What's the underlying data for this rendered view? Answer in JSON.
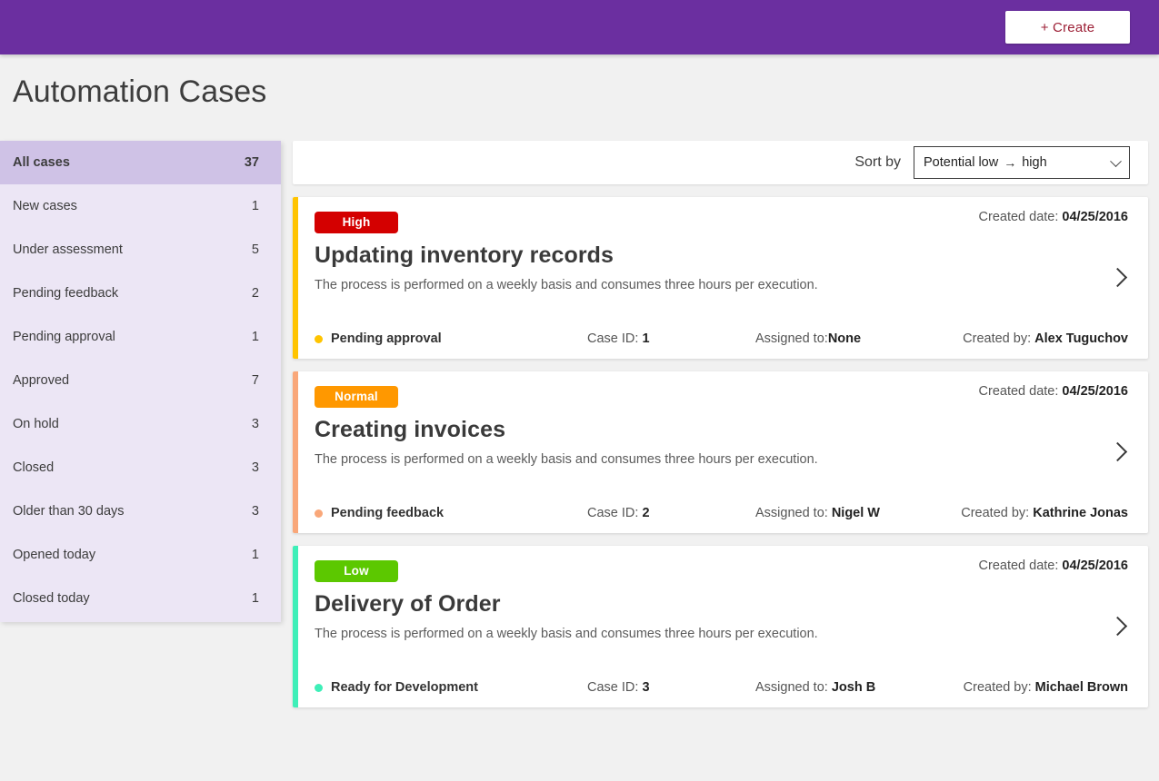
{
  "topbar": {
    "create_label": "+ Create",
    "bg_color": "#6b2fa0"
  },
  "page_title": "Automation Cases",
  "sidebar": {
    "items": [
      {
        "label": "All cases",
        "count": "37",
        "active": true
      },
      {
        "label": "New cases",
        "count": "1",
        "active": false
      },
      {
        "label": "Under assessment",
        "count": "5",
        "active": false
      },
      {
        "label": "Pending feedback",
        "count": "2",
        "active": false
      },
      {
        "label": "Pending approval",
        "count": "1",
        "active": false
      },
      {
        "label": "Approved",
        "count": "7",
        "active": false
      },
      {
        "label": "On hold",
        "count": "3",
        "active": false
      },
      {
        "label": "Closed",
        "count": "3",
        "active": false
      },
      {
        "label": "Older than 30 days",
        "count": "3",
        "active": false
      },
      {
        "label": "Opened today",
        "count": "1",
        "active": false
      },
      {
        "label": "Closed today",
        "count": "1",
        "active": false
      }
    ]
  },
  "sortbar": {
    "label": "Sort by",
    "selected": "Potential low",
    "arrow": "→",
    "selected_tail": "high",
    "options": [
      "Potential low → high"
    ]
  },
  "cards": [
    {
      "priority": "High",
      "priority_color": "#d40000",
      "accent_color": "#ffc400",
      "title": "Updating inventory records",
      "description": "The process is performed on a weekly basis and consumes three hours per execution.",
      "created_date_label": "Created date: ",
      "created_date": "04/25/2016",
      "status": "Pending approval",
      "status_dot_color": "#ffc400",
      "case_id_label": "Case ID: ",
      "case_id": "1",
      "assigned_label": "Assigned to:",
      "assigned_to": "None",
      "created_by_label": "Created by: ",
      "created_by": "Alex Tuguchov"
    },
    {
      "priority": "Normal",
      "priority_color": "#ff9800",
      "accent_color": "#f9a779",
      "title": "Creating invoices",
      "description": "The process is performed on a weekly basis and consumes three hours per execution.",
      "created_date_label": "Created date: ",
      "created_date": "04/25/2016",
      "status": "Pending feedback",
      "status_dot_color": "#f9a779",
      "case_id_label": "Case ID: ",
      "case_id": "2",
      "assigned_label": "Assigned to: ",
      "assigned_to": " Nigel W",
      "created_by_label": "Created by: ",
      "created_by": "Kathrine Jonas"
    },
    {
      "priority": "Low",
      "priority_color": "#5cc800",
      "accent_color": "#3eefb8",
      "title": "Delivery of Order",
      "description": "The process is performed on a weekly basis and consumes three hours per execution.",
      "created_date_label": "Created date: ",
      "created_date": "04/25/2016",
      "status": "Ready for Development",
      "status_dot_color": "#3eefb8",
      "case_id_label": "Case ID: ",
      "case_id": "3",
      "assigned_label": "Assigned to: ",
      "assigned_to": " Josh B",
      "created_by_label": "Created by: ",
      "created_by": "Michael Brown"
    }
  ],
  "icons": {
    "chevron_down": "chevron-down-icon",
    "chevron_right": "chevron-right-icon"
  }
}
